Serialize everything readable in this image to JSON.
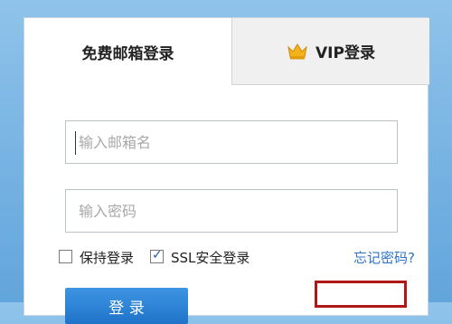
{
  "tabs": {
    "free_label": "免费邮箱登录",
    "vip_label": "VIP登录"
  },
  "form": {
    "email_placeholder": "输入邮箱名",
    "password_placeholder": "输入密码"
  },
  "options": {
    "keep_login_label": "保持登录",
    "keep_login_checked": false,
    "ssl_label": "SSL安全登录",
    "ssl_checked": true,
    "forgot_password_label": "忘记密码?"
  },
  "login_button_label": "登 录",
  "icons": {
    "crown": "crown-icon",
    "checkbox_check": "checkmark-icon"
  },
  "colors": {
    "background": "#62a5dc",
    "accent": "#1f73c9",
    "link": "#2e73c4",
    "highlight_box": "#b01818",
    "crown": "#f3b11c"
  }
}
